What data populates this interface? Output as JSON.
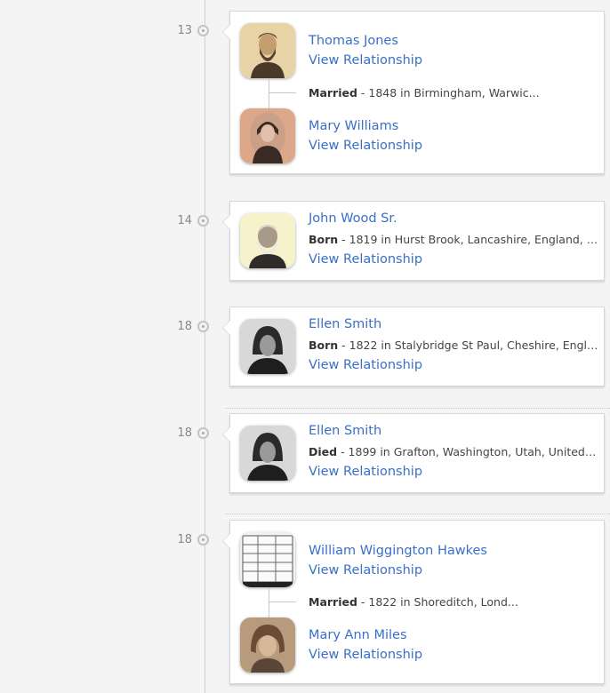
{
  "events": [
    {
      "year": "13",
      "type": "marriage",
      "person1": {
        "name": "Thomas Jones",
        "link": "View Relationship",
        "photo_icon": "portrait-man-bearded-sepia"
      },
      "fact": {
        "label": "Married",
        "text": " - 1848 in Birmingham, Warwic..."
      },
      "person2": {
        "name": "Mary Williams",
        "link": "View Relationship",
        "photo_icon": "portrait-woman-sepia"
      }
    },
    {
      "year": "14",
      "type": "single",
      "person": {
        "name": "John Wood Sr.",
        "link": "View Relationship",
        "photo_icon": "portrait-old-man-white-beard"
      },
      "fact": {
        "label": "Born",
        "text": " - 1819 in Hurst Brook, Lancashire, England, U..."
      }
    },
    {
      "year": "18",
      "type": "single",
      "person": {
        "name": "Ellen Smith",
        "link": "View Relationship",
        "photo_icon": "portrait-woman-bw"
      },
      "fact": {
        "label": "Born",
        "text": " - 1822 in Stalybridge St Paul, Cheshire, Engla..."
      }
    },
    {
      "year": "18",
      "type": "single",
      "person": {
        "name": "Ellen Smith",
        "link": "View Relationship",
        "photo_icon": "portrait-woman-bw"
      },
      "fact": {
        "label": "Died",
        "text": " - 1899 in Grafton, Washington, Utah, United St..."
      }
    },
    {
      "year": "18",
      "type": "marriage",
      "person1": {
        "name": "William Wiggington Hawkes",
        "link": "View Relationship",
        "photo_icon": "document-record"
      },
      "fact": {
        "label": "Married",
        "text": " - 1822 in Shoreditch, Lond..."
      },
      "person2": {
        "name": "Mary Ann Miles",
        "link": "View Relationship",
        "photo_icon": "portrait-woman-sepia-curls"
      }
    }
  ]
}
